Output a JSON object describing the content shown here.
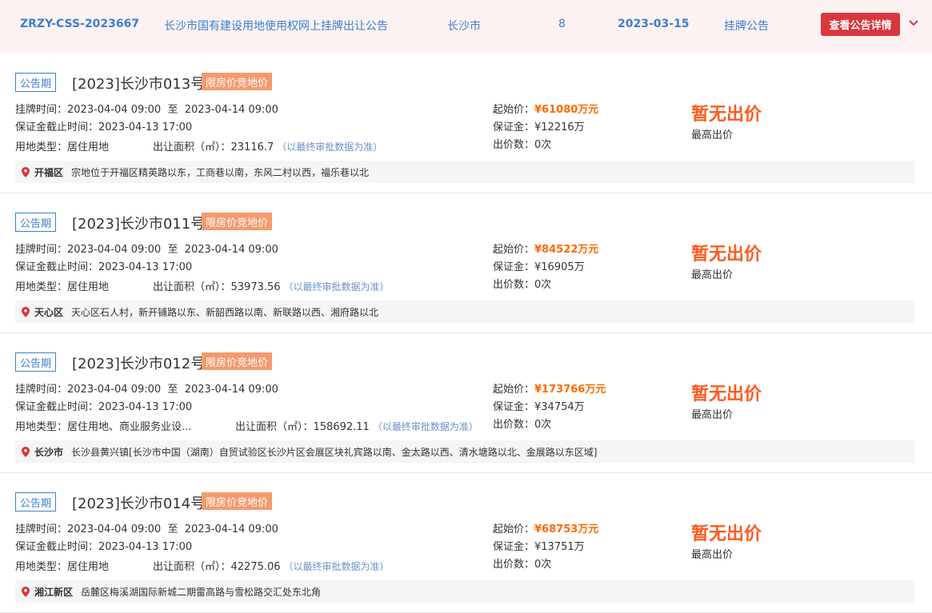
{
  "header": {
    "code": "ZRZY-CSS-2023667",
    "title": "长沙市国有建设用地使用权网上挂牌出让公告",
    "city": "长沙市",
    "count": "8",
    "date": "2023-03-15",
    "type": "挂牌公告",
    "detail_button": "查看公告详情",
    "expand_icon": "chevron-down-icon"
  },
  "labels": {
    "listing_time_prefix": "挂牌时间：",
    "deposit_deadline_prefix": "保证金截止时间：",
    "land_use_prefix": "用地类型：",
    "area_prefix": "出让面积（㎡）：",
    "area_note": "（以最终审批数据为准）",
    "start_price_prefix": "起始价：",
    "deposit_prefix": "保证金：",
    "bids_prefix": "出价数：",
    "no_bid": "暂无出价",
    "highest_bid": "最高出价",
    "to": "至"
  },
  "lots": [
    {
      "status": "公告期",
      "title": "[2023]长沙市013号",
      "mode": "限房价竞地价",
      "listing_start": "2023-04-04 09:00",
      "listing_end": "2023-04-14 09:00",
      "deposit_deadline": "2023-04-13 17:00",
      "land_use": "居住用地",
      "area": "23116.7",
      "start_price": "¥61080万元",
      "deposit": "¥12216万",
      "bids": "0次",
      "district": "开福区",
      "location": "宗地位于开福区精英路以东，工商巷以南，东风二村以西，福乐巷以北"
    },
    {
      "status": "公告期",
      "title": "[2023]长沙市011号",
      "mode": "限房价竞地价",
      "listing_start": "2023-04-04 09:00",
      "listing_end": "2023-04-14 09:00",
      "deposit_deadline": "2023-04-13 17:00",
      "land_use": "居住用地",
      "area": "53973.56",
      "start_price": "¥84522万元",
      "deposit": "¥16905万",
      "bids": "0次",
      "district": "天心区",
      "location": "天心区石人村，新开铺路以东、新韶西路以南、新联路以西、湘府路以北"
    },
    {
      "status": "公告期",
      "title": "[2023]长沙市012号",
      "mode": "限房价竞地价",
      "listing_start": "2023-04-04 09:00",
      "listing_end": "2023-04-14 09:00",
      "deposit_deadline": "2023-04-13 17:00",
      "land_use": "居住用地、商业服务业设...",
      "area": "158692.11",
      "start_price": "¥173766万元",
      "deposit": "¥34754万",
      "bids": "0次",
      "district": "长沙市",
      "location": "长沙县黄兴镇[长沙市中国（湖南）自贸试验区长沙片区会展区块礼宾路以南、金太路以西、清水塘路以北、金展路以东区域]"
    },
    {
      "status": "公告期",
      "title": "[2023]长沙市014号",
      "mode": "限房价竞地价",
      "listing_start": "2023-04-04 09:00",
      "listing_end": "2023-04-14 09:00",
      "deposit_deadline": "2023-04-13 17:00",
      "land_use": "居住用地",
      "area": "42275.06",
      "start_price": "¥68753万元",
      "deposit": "¥13751万",
      "bids": "0次",
      "district": "湘江新区",
      "location": "岳麓区梅溪湖国际新城二期雷高路与雪松路交汇处东北角"
    }
  ],
  "colors": {
    "accent_blue": "#3d7fd1",
    "button_red": "#d9363e",
    "mode_orange": "#f59a6e",
    "price_orange": "#ff6a00",
    "no_bid_red": "#ff5a1f",
    "pin_red": "#d9363e"
  }
}
